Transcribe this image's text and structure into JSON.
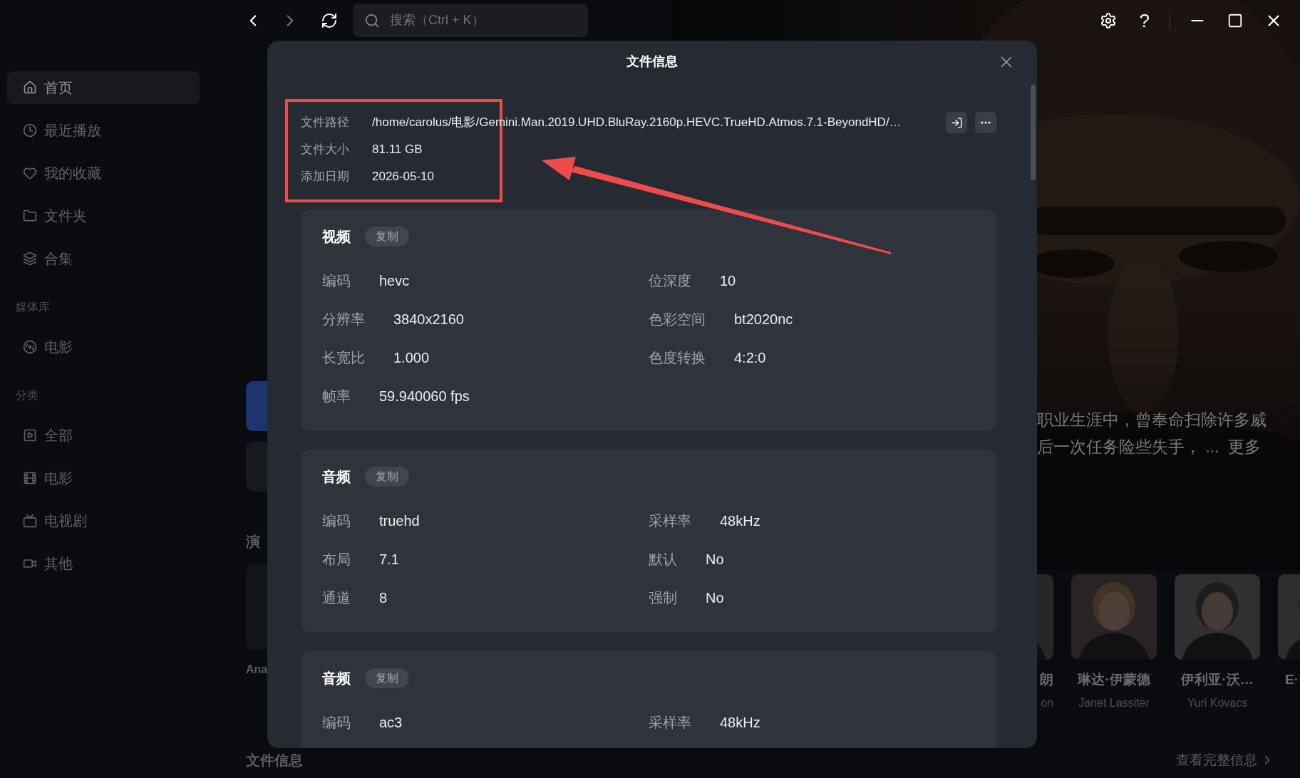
{
  "search": {
    "placeholder": "搜索（Ctrl + K）"
  },
  "help_glyph": "?",
  "sidebar": {
    "items": [
      {
        "label": "首页",
        "selected": true
      },
      {
        "label": "最近播放",
        "selected": false
      },
      {
        "label": "我的收藏",
        "selected": false
      },
      {
        "label": "文件夹",
        "selected": false
      },
      {
        "label": "合集",
        "selected": false
      }
    ],
    "sections": [
      {
        "heading": "媒体库",
        "items": [
          {
            "label": "电影",
            "selected": false
          }
        ]
      },
      {
        "heading": "分类",
        "items": [
          {
            "label": "全部",
            "selected": false
          },
          {
            "label": "电影",
            "selected": false
          },
          {
            "label": "电视剧",
            "selected": false
          },
          {
            "label": "其他",
            "selected": false
          }
        ]
      }
    ]
  },
  "background": {
    "cast_heading": "演",
    "left_cast_name": "Ana",
    "description": [
      "职业生涯中，曾奉命扫除许多威",
      "后一次任务险些失手， ..."
    ],
    "more_link": "更多",
    "cast": [
      {
        "name": "朗",
        "role": "on"
      },
      {
        "name": "琳达·伊蒙德",
        "role": "Janet Lassiter"
      },
      {
        "name": "伊利亚·沃…",
        "role": "Yuri Kovacs"
      },
      {
        "name": "E·"
      }
    ],
    "file_info_heading": "文件信息",
    "full_info_link": "查看完整信息"
  },
  "dialog": {
    "title": "文件信息",
    "file": [
      {
        "label": "文件路径",
        "value": "/home/carolus/电影/Gemini.Man.2019.UHD.BluRay.2160p.HEVC.TrueHD.Atmos.7.1-BeyondHD/…"
      },
      {
        "label": "文件大小",
        "value": "81.11 GB"
      },
      {
        "label": "添加日期",
        "value": "2026-05-10"
      }
    ],
    "sections": [
      {
        "title": "视频",
        "copy": "复制",
        "columns": [
          [
            {
              "label": "编码",
              "value": "hevc"
            },
            {
              "label": "分辨率",
              "value": "3840x2160"
            },
            {
              "label": "长宽比",
              "value": "1.000"
            },
            {
              "label": "帧率",
              "value": "59.940060 fps"
            }
          ],
          [
            {
              "label": "位深度",
              "value": "10"
            },
            {
              "label": "色彩空间",
              "value": "bt2020nc"
            },
            {
              "label": "色度转换",
              "value": "4:2:0"
            }
          ]
        ]
      },
      {
        "title": "音频",
        "copy": "复制",
        "columns": [
          [
            {
              "label": "编码",
              "value": "truehd"
            },
            {
              "label": "布局",
              "value": "7.1"
            },
            {
              "label": "通道",
              "value": "8"
            }
          ],
          [
            {
              "label": "采样率",
              "value": "48kHz"
            },
            {
              "label": "默认",
              "value": "No"
            },
            {
              "label": "强制",
              "value": "No"
            }
          ]
        ]
      },
      {
        "title": "音频",
        "copy": "复制",
        "columns": [
          [
            {
              "label": "编码",
              "value": "ac3"
            }
          ],
          [
            {
              "label": "采样率",
              "value": "48kHz"
            }
          ]
        ]
      }
    ]
  }
}
